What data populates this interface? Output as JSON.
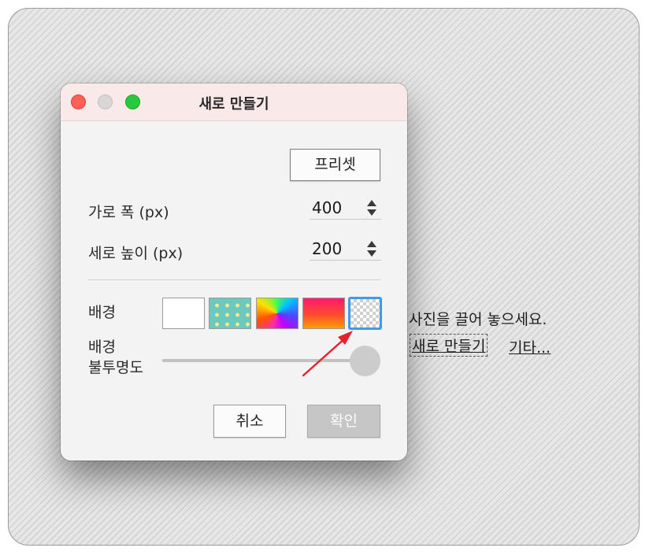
{
  "main": {
    "drop_hint": "사진을 끌어 놓으세요.",
    "new_link": "새로 만들기",
    "other_link": "기타..."
  },
  "dialog": {
    "title": "새로 만들기",
    "presets_label": "프리셋",
    "width_label": "가로 폭 (px)",
    "width_value": "400",
    "height_label": "세로 높이 (px)",
    "height_value": "200",
    "background_label": "배경",
    "opacity_label_line1": "배경",
    "opacity_label_line2": "불투명도",
    "opacity_value": 1.0,
    "swatches": [
      "white",
      "teal-dots",
      "rainbow",
      "red-orange-gradient",
      "transparent"
    ],
    "selected_swatch": "transparent",
    "cancel_label": "취소",
    "confirm_label": "확인"
  },
  "colors": {
    "close": "#fe5f57",
    "minimize": "#d9d6d5",
    "zoom": "#28c840",
    "selection": "#3d9bea",
    "annotation_arrow": "#e8202a"
  }
}
